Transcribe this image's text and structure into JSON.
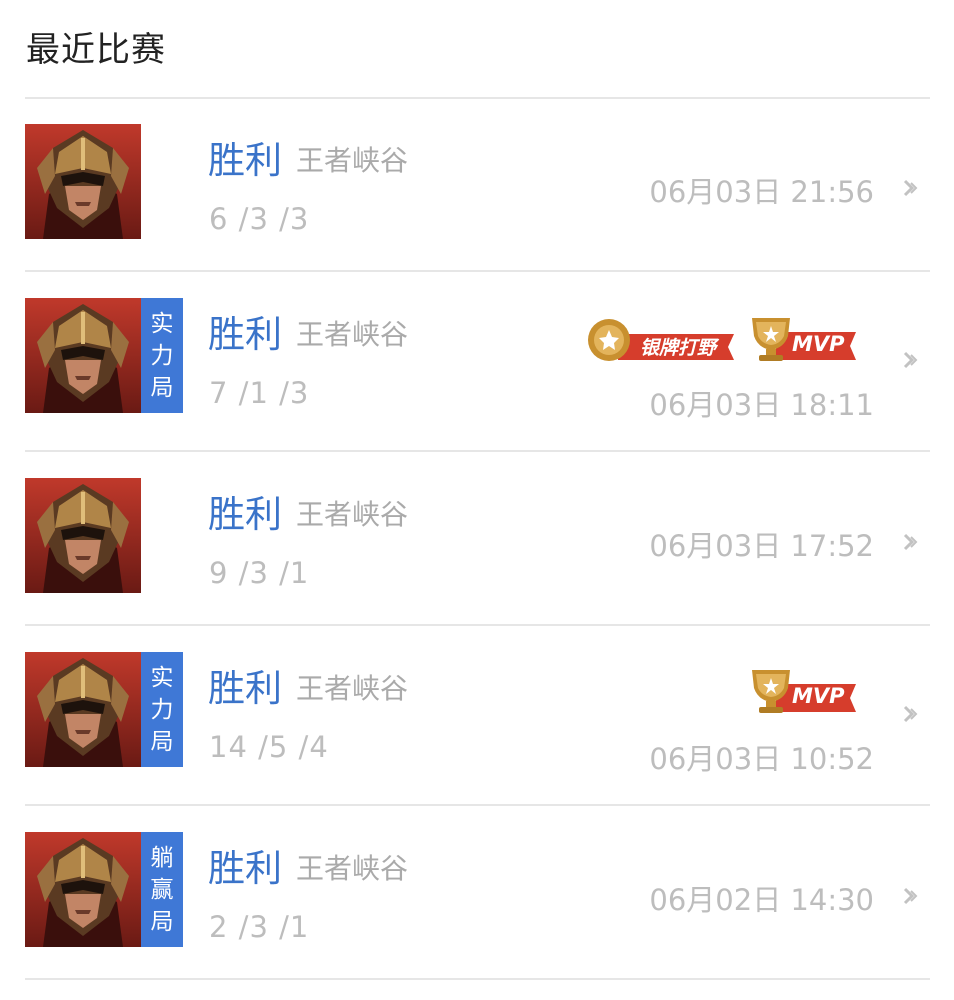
{
  "header": {
    "title": "最近比赛"
  },
  "colors": {
    "result_win": "#3a73c9",
    "mode_tag_bg": "#3f78d6",
    "muted_text": "#bdbdbd",
    "badge_gold": "#c8902f",
    "ribbon_red": "#d63d2c"
  },
  "matches": [
    {
      "result": "胜利",
      "map": "王者峡谷",
      "kda": "6 /3 /3",
      "time": "06月03日 21:56",
      "mode_tag": [],
      "badges": []
    },
    {
      "result": "胜利",
      "map": "王者峡谷",
      "kda": "7 /1 /3",
      "time": "06月03日 18:11",
      "mode_tag": [
        "实",
        "力",
        "局"
      ],
      "badges": [
        {
          "icon": "silver-medal-icon",
          "label": "银牌打野"
        },
        {
          "icon": "trophy-icon",
          "label": "MVP"
        }
      ]
    },
    {
      "result": "胜利",
      "map": "王者峡谷",
      "kda": "9 /3 /1",
      "time": "06月03日 17:52",
      "mode_tag": [],
      "badges": []
    },
    {
      "result": "胜利",
      "map": "王者峡谷",
      "kda": "14 /5 /4",
      "time": "06月03日 10:52",
      "mode_tag": [
        "实",
        "力",
        "局"
      ],
      "badges": [
        {
          "icon": "trophy-icon",
          "label": "MVP"
        }
      ]
    },
    {
      "result": "胜利",
      "map": "王者峡谷",
      "kda": "2 /3 /1",
      "time": "06月02日 14:30",
      "mode_tag": [
        "躺",
        "赢",
        "局"
      ],
      "badges": []
    }
  ]
}
